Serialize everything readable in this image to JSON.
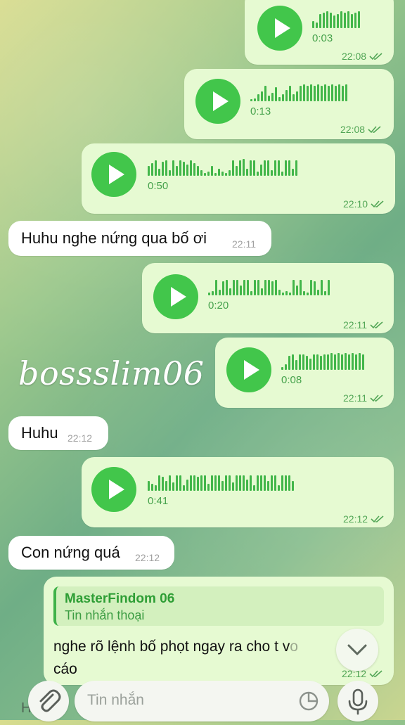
{
  "chat": {
    "messages": [
      {
        "type": "voice",
        "duration": "0:03",
        "time": "22:08"
      },
      {
        "type": "voice",
        "duration": "0:13",
        "time": "22:08"
      },
      {
        "type": "voice",
        "duration": "0:50",
        "time": "22:10"
      },
      {
        "type": "text",
        "text": "Huhu nghe nứng qua bố ơi",
        "time": "22:11"
      },
      {
        "type": "voice",
        "duration": "0:20",
        "time": "22:11"
      },
      {
        "type": "voice",
        "duration": "0:08",
        "time": "22:11"
      },
      {
        "type": "text",
        "text": "Huhu",
        "time": "22:12"
      },
      {
        "type": "voice",
        "duration": "0:41",
        "time": "22:12"
      },
      {
        "type": "text",
        "text": "Con nứng quá",
        "time": "22:12"
      },
      {
        "type": "reply",
        "reply_to_name": "MasterFindom 06",
        "reply_to_text": "Tin nhắn thoại",
        "text_line1": "nghe rõ lệnh bố phọt ngay ra cho t v",
        "text_line1_tail": "o",
        "text_line2": "cáo",
        "time": "22:12"
      }
    ]
  },
  "watermark": "bossslim06",
  "composer": {
    "placeholder": "Tin nhắn",
    "underlay_text": "H"
  },
  "icons": {
    "play": "play-icon",
    "read": "double-check-icon",
    "attach": "paperclip-icon",
    "sticker": "sticker-icon",
    "mic": "microphone-icon",
    "scroll": "chevron-down-icon"
  },
  "colors": {
    "accent": "#42c64b",
    "outgoing_bubble": "#e6fad2",
    "incoming_bubble": "#ffffff"
  }
}
